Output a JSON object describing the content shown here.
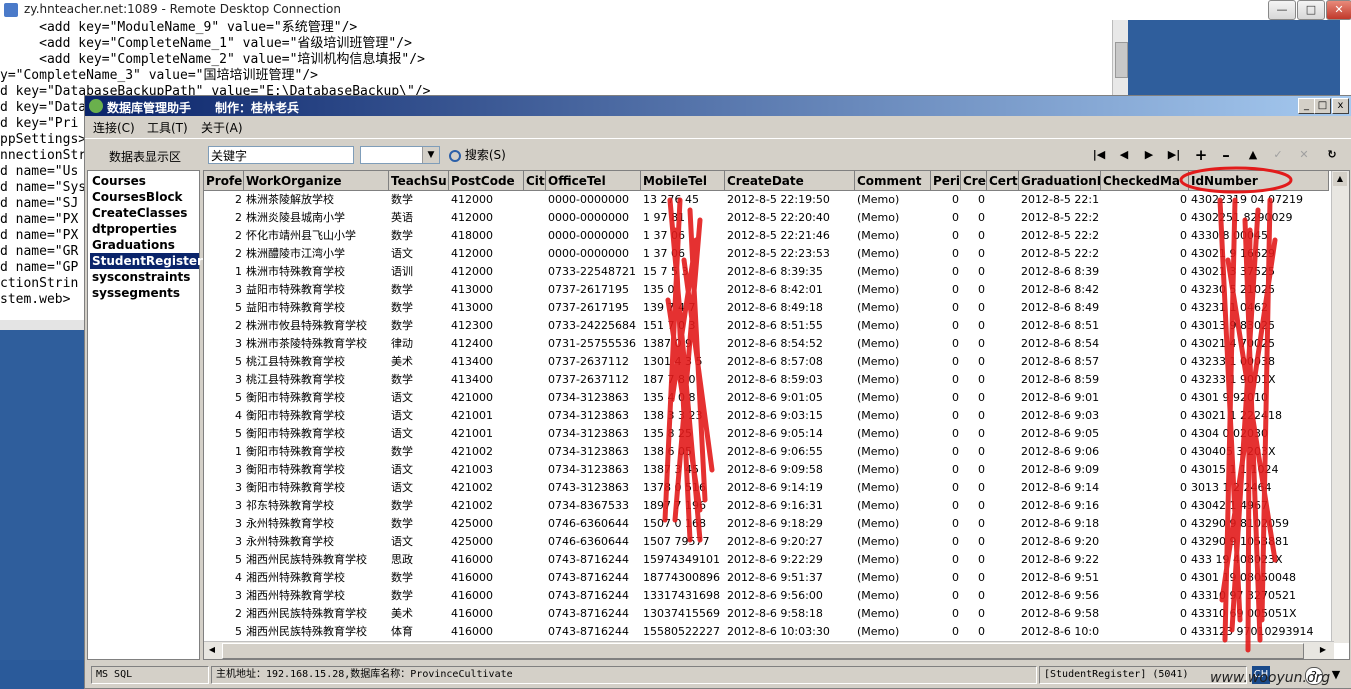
{
  "rdp": {
    "title": "zy.hnteacher.net:1089 - Remote Desktop Connection"
  },
  "background_lines": [
    "     <add key=\"ModuleName_9\" value=\"系统管理\"/>",
    "     <add key=\"CompleteName_1\" value=\"省级培训班管理\"/>",
    "     <add key=\"CompleteName_2\" value=\"培训机构信息填报\"/>",
    "y=\"CompleteName_3\" value=\"国培培训班管理\"/>",
    "d key=\"DatabaseBackupPath\" value=\"E:\\DatabaseBackup\\\"/>",
    "d key=\"Data",
    "d key=\"Pri",
    "ppSettings>",
    "nnectionStr",
    "d name=\"Us",
    "d name=\"Sys",
    "d name=\"SJ",
    "d name=\"PX",
    "d name=\"PX",
    "d name=\"GR",
    "d name=\"GP",
    "ctionStrin",
    "stem.web>"
  ],
  "app": {
    "title": "数据库管理助手",
    "subtitle": "制作：桂林老兵",
    "menu": [
      "连接(C)",
      "工具(T)",
      "关于(A)"
    ],
    "area_label": "数据表显示区",
    "search_value": "关键字",
    "search_button": "搜索(S)",
    "nav_icons": [
      "first-icon",
      "prev-icon",
      "next-icon",
      "last-icon",
      "add-icon",
      "delete-icon",
      "up-icon",
      "check-icon",
      "cancel-icon",
      "refresh-icon"
    ]
  },
  "tables": [
    "Courses",
    "CoursesBlock",
    "CreateClasses",
    "dtproperties",
    "Graduations",
    "StudentRegister",
    "sysconstraints",
    "syssegments"
  ],
  "selected_table": "StudentRegister",
  "columns": [
    "Profes",
    "WorkOrganize",
    "TeachSu",
    "PostCode",
    "City",
    "OfficeTel",
    "MobileTel",
    "CreateDate",
    "Comment",
    "Peri",
    "Cre",
    "Certi",
    "GraduationD",
    "CheckedMa",
    "IdNumber"
  ],
  "rows": [
    [
      "2",
      "株洲茶陵解放学校",
      "数学",
      "412000",
      "",
      "0000-0000000",
      "13 276  45",
      "2012-8-5 22:19:50",
      "(Memo)",
      "0",
      "0",
      "",
      "2012-8-5 22:1",
      "0",
      "43022319 04  07219"
    ],
    [
      "2",
      "株洲炎陵县城南小学",
      "英语",
      "412000",
      "",
      "0000-0000000",
      "1 97    81",
      "2012-8-5 22:20:40",
      "(Memo)",
      "0",
      "0",
      "",
      "2012-8-5 22:2",
      "0",
      "4302251  8290029"
    ],
    [
      "2",
      "怀化市靖州县飞山小学",
      "数学",
      "418000",
      "",
      "0000-0000000",
      "1 37    06",
      "2012-8-5 22:21:46",
      "(Memo)",
      "0",
      "0",
      "",
      "2012-8-5 22:2",
      "0",
      "4330  8  00045"
    ],
    [
      "2",
      "株洲醴陵市江湾小学",
      "语文",
      "412000",
      "",
      "0000-0000000",
      "1 37    06",
      "2012-8-5 22:23:53",
      "(Memo)",
      "0",
      "0",
      "",
      "2012-8-5 22:2",
      "0",
      "43021  9  16629"
    ],
    [
      "1",
      "株洲市特殊教育学校",
      "语训",
      "412000",
      "",
      "0733-22548721",
      "15 7   5 3",
      "2012-8-6 8:39:35",
      "(Memo)",
      "0",
      "0",
      "",
      "2012-8-6 8:39",
      "0",
      "43021  3  37525"
    ],
    [
      "3",
      "益阳市特殊教育学校",
      "数学",
      "413000",
      "",
      "0737-2617195",
      "135     0",
      "2012-8-6 8:42:01",
      "(Memo)",
      "0",
      "0",
      "",
      "2012-8-6 8:42",
      "0",
      "43230  5  21025"
    ],
    [
      "5",
      "益阳市特殊教育学校",
      "数学",
      "413000",
      "",
      "0737-2617195",
      "139   7 4 7",
      "2012-8-6 8:49:18",
      "(Memo)",
      "0",
      "0",
      "",
      "2012-8-6 8:49",
      "0",
      "43231  1  0462"
    ],
    [
      "2",
      "株洲市攸县特殊教育学校",
      "数学",
      "412300",
      "",
      "0733-24225684",
      "151  7 0 3",
      "2012-8-6 8:51:55",
      "(Memo)",
      "0",
      "0",
      "",
      "2012-8-6 8:51",
      "0",
      "43013  9  83025"
    ],
    [
      "3",
      "株洲市茶陵特殊教育学校",
      "律动",
      "412400",
      "",
      "0731-25755536",
      "1387   0 9",
      "2012-8-6 8:54:52",
      "(Memo)",
      "0",
      "0",
      "",
      "2012-8-6 8:54",
      "0",
      "43021  4  70025"
    ],
    [
      "5",
      "桃江县特殊教育学校",
      "美术",
      "413400",
      "",
      "0737-2637112",
      "1301   4 3 5",
      "2012-8-6 8:57:08",
      "(Memo)",
      "0",
      "0",
      "",
      "2012-8-6 8:57",
      "0",
      "43233  1  00038"
    ],
    [
      "3",
      "桃江县特殊教育学校",
      "数学",
      "413400",
      "",
      "0737-2637112",
      "187  7 8 0",
      "2012-8-6 8:59:03",
      "(Memo)",
      "0",
      "0",
      "",
      "2012-8-6 8:59",
      "0",
      "43233  1  9001X"
    ],
    [
      "5",
      "衡阳市特殊教育学校",
      "语文",
      "421000",
      "",
      "0734-3123863",
      "135  4 0 8",
      "2012-8-6 9:01:05",
      "(Memo)",
      "0",
      "0",
      "",
      "2012-8-6 9:01",
      "0",
      "4301  9  92010"
    ],
    [
      "4",
      "衡阳市特殊教育学校",
      "语文",
      "421001",
      "",
      "0734-3123863",
      "138  3 3 23",
      "2012-8-6 9:03:15",
      "(Memo)",
      "0",
      "0",
      "",
      "2012-8-6 9:03",
      "0",
      "43021  1  222418"
    ],
    [
      "5",
      "衡阳市特殊教育学校",
      "语文",
      "421001",
      "",
      "0734-3123863",
      "135   8 25",
      "2012-8-6 9:05:14",
      "(Memo)",
      "0",
      "0",
      "",
      "2012-8-6 9:05",
      "0",
      "4304  0  02030"
    ],
    [
      "1",
      "衡阳市特殊教育学校",
      "数学",
      "421002",
      "",
      "0734-3123863",
      "138   6 05",
      "2012-8-6 9:06:55",
      "(Memo)",
      "0",
      "0",
      "",
      "2012-8-6 9:06",
      "0",
      "430405  3  203X"
    ],
    [
      "3",
      "衡阳市特殊教育学校",
      "语文",
      "421003",
      "",
      "0734-3123863",
      "1387   3 45",
      "2012-8-6 9:09:58",
      "(Memo)",
      "0",
      "0",
      "",
      "2012-8-6 9:09",
      "0",
      "43015  1 1  1024"
    ],
    [
      "3",
      "衡阳市特殊教育学校",
      "语文",
      "421002",
      "",
      "0743-3123863",
      "1378  0 516",
      "2012-8-6 9:14:19",
      "(Memo)",
      "0",
      "0",
      "",
      "2012-8-6 9:14",
      "0",
      "3013  1 2  2464"
    ],
    [
      "3",
      "祁东特殊教育学校",
      "数学",
      "421002",
      "",
      "0734-8367533",
      "1897   7 196",
      "2012-8-6 9:16:31",
      "(Memo)",
      "0",
      "0",
      "",
      "2012-8-6 9:16",
      "0",
      "43042  1  4967"
    ],
    [
      "3",
      "永州特殊教育学校",
      "数学",
      "425000",
      "",
      "0746-6360644",
      "1507  0 168",
      "2012-8-6 9:18:29",
      "(Memo)",
      "0",
      "0",
      "",
      "2012-8-6 9:18",
      "0",
      "43290  9  8102059"
    ],
    [
      "3",
      "永州特殊教育学校",
      "语文",
      "425000",
      "",
      "0746-6360644",
      "1507  79577",
      "2012-8-6 9:20:27",
      "(Memo)",
      "0",
      "0",
      "",
      "2012-8-6 9:20",
      "0",
      "43290  9  1053881"
    ],
    [
      "5",
      "湘西州民族特殊教育学校",
      "思政",
      "416000",
      "",
      "0743-8716244",
      "15974349101",
      "2012-8-6 9:22:29",
      "(Memo)",
      "0",
      "0",
      "",
      "2012-8-6 9:22",
      "0",
      "433  19  408023X"
    ],
    [
      "4",
      "湘西州特殊教育学校",
      "数学",
      "416000",
      "",
      "0743-8716244",
      "18774300896",
      "2012-8-6 9:51:37",
      "(Memo)",
      "0",
      "0",
      "",
      "2012-8-6 9:51",
      "0",
      "4301  19  08050048"
    ],
    [
      "3",
      "湘西州特殊教育学校",
      "数学",
      "416000",
      "",
      "0743-8716244",
      "13317431698",
      "2012-8-6 9:56:00",
      "(Memo)",
      "0",
      "0",
      "",
      "2012-8-6 9:56",
      "0",
      "43310  97  3270521"
    ],
    [
      "2",
      "湘西州民族特殊教育学校",
      "美术",
      "416000",
      "",
      "0743-8716244",
      "13037415569",
      "2012-8-6 9:58:18",
      "(Memo)",
      "0",
      "0",
      "",
      "2012-8-6 9:58",
      "0",
      "43310  69  005051X"
    ],
    [
      "5",
      "湘西州民族特殊教育学校",
      "体育",
      "416000",
      "",
      "0743-8716244",
      "15580522227",
      "2012-8-6 10:03:30",
      "(Memo)",
      "0",
      "0",
      "",
      "2012-8-6 10:0",
      "0",
      "433123  97010293914"
    ]
  ],
  "status": {
    "db": "MS SQL",
    "host": "主机地址：192.168.15.28,数据库名称：ProvinceCultivate",
    "table": "[StudentRegister]  (5041)"
  },
  "watermark": "www.wooyun.org",
  "tray": "CH",
  "colors": {
    "title_start": "#0a246a",
    "title_end": "#a6caf0",
    "selection": "#0a246a",
    "scribble": "#e21b1b"
  }
}
